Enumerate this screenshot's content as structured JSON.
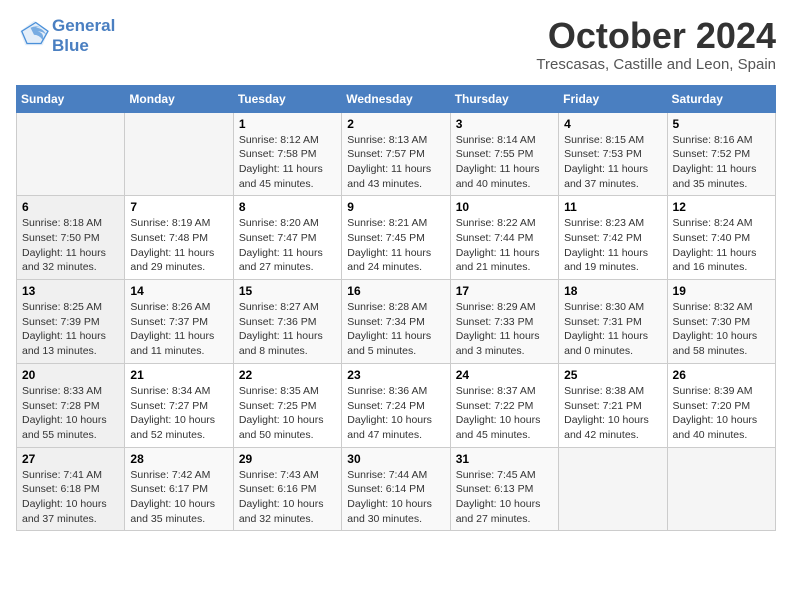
{
  "header": {
    "logo_line1": "General",
    "logo_line2": "Blue",
    "month": "October 2024",
    "location": "Trescasas, Castille and Leon, Spain"
  },
  "days_of_week": [
    "Sunday",
    "Monday",
    "Tuesday",
    "Wednesday",
    "Thursday",
    "Friday",
    "Saturday"
  ],
  "weeks": [
    [
      {
        "day": "",
        "info": ""
      },
      {
        "day": "",
        "info": ""
      },
      {
        "day": "1",
        "info": "Sunrise: 8:12 AM\nSunset: 7:58 PM\nDaylight: 11 hours and 45 minutes."
      },
      {
        "day": "2",
        "info": "Sunrise: 8:13 AM\nSunset: 7:57 PM\nDaylight: 11 hours and 43 minutes."
      },
      {
        "day": "3",
        "info": "Sunrise: 8:14 AM\nSunset: 7:55 PM\nDaylight: 11 hours and 40 minutes."
      },
      {
        "day": "4",
        "info": "Sunrise: 8:15 AM\nSunset: 7:53 PM\nDaylight: 11 hours and 37 minutes."
      },
      {
        "day": "5",
        "info": "Sunrise: 8:16 AM\nSunset: 7:52 PM\nDaylight: 11 hours and 35 minutes."
      }
    ],
    [
      {
        "day": "6",
        "info": "Sunrise: 8:18 AM\nSunset: 7:50 PM\nDaylight: 11 hours and 32 minutes."
      },
      {
        "day": "7",
        "info": "Sunrise: 8:19 AM\nSunset: 7:48 PM\nDaylight: 11 hours and 29 minutes."
      },
      {
        "day": "8",
        "info": "Sunrise: 8:20 AM\nSunset: 7:47 PM\nDaylight: 11 hours and 27 minutes."
      },
      {
        "day": "9",
        "info": "Sunrise: 8:21 AM\nSunset: 7:45 PM\nDaylight: 11 hours and 24 minutes."
      },
      {
        "day": "10",
        "info": "Sunrise: 8:22 AM\nSunset: 7:44 PM\nDaylight: 11 hours and 21 minutes."
      },
      {
        "day": "11",
        "info": "Sunrise: 8:23 AM\nSunset: 7:42 PM\nDaylight: 11 hours and 19 minutes."
      },
      {
        "day": "12",
        "info": "Sunrise: 8:24 AM\nSunset: 7:40 PM\nDaylight: 11 hours and 16 minutes."
      }
    ],
    [
      {
        "day": "13",
        "info": "Sunrise: 8:25 AM\nSunset: 7:39 PM\nDaylight: 11 hours and 13 minutes."
      },
      {
        "day": "14",
        "info": "Sunrise: 8:26 AM\nSunset: 7:37 PM\nDaylight: 11 hours and 11 minutes."
      },
      {
        "day": "15",
        "info": "Sunrise: 8:27 AM\nSunset: 7:36 PM\nDaylight: 11 hours and 8 minutes."
      },
      {
        "day": "16",
        "info": "Sunrise: 8:28 AM\nSunset: 7:34 PM\nDaylight: 11 hours and 5 minutes."
      },
      {
        "day": "17",
        "info": "Sunrise: 8:29 AM\nSunset: 7:33 PM\nDaylight: 11 hours and 3 minutes."
      },
      {
        "day": "18",
        "info": "Sunrise: 8:30 AM\nSunset: 7:31 PM\nDaylight: 11 hours and 0 minutes."
      },
      {
        "day": "19",
        "info": "Sunrise: 8:32 AM\nSunset: 7:30 PM\nDaylight: 10 hours and 58 minutes."
      }
    ],
    [
      {
        "day": "20",
        "info": "Sunrise: 8:33 AM\nSunset: 7:28 PM\nDaylight: 10 hours and 55 minutes."
      },
      {
        "day": "21",
        "info": "Sunrise: 8:34 AM\nSunset: 7:27 PM\nDaylight: 10 hours and 52 minutes."
      },
      {
        "day": "22",
        "info": "Sunrise: 8:35 AM\nSunset: 7:25 PM\nDaylight: 10 hours and 50 minutes."
      },
      {
        "day": "23",
        "info": "Sunrise: 8:36 AM\nSunset: 7:24 PM\nDaylight: 10 hours and 47 minutes."
      },
      {
        "day": "24",
        "info": "Sunrise: 8:37 AM\nSunset: 7:22 PM\nDaylight: 10 hours and 45 minutes."
      },
      {
        "day": "25",
        "info": "Sunrise: 8:38 AM\nSunset: 7:21 PM\nDaylight: 10 hours and 42 minutes."
      },
      {
        "day": "26",
        "info": "Sunrise: 8:39 AM\nSunset: 7:20 PM\nDaylight: 10 hours and 40 minutes."
      }
    ],
    [
      {
        "day": "27",
        "info": "Sunrise: 7:41 AM\nSunset: 6:18 PM\nDaylight: 10 hours and 37 minutes."
      },
      {
        "day": "28",
        "info": "Sunrise: 7:42 AM\nSunset: 6:17 PM\nDaylight: 10 hours and 35 minutes."
      },
      {
        "day": "29",
        "info": "Sunrise: 7:43 AM\nSunset: 6:16 PM\nDaylight: 10 hours and 32 minutes."
      },
      {
        "day": "30",
        "info": "Sunrise: 7:44 AM\nSunset: 6:14 PM\nDaylight: 10 hours and 30 minutes."
      },
      {
        "day": "31",
        "info": "Sunrise: 7:45 AM\nSunset: 6:13 PM\nDaylight: 10 hours and 27 minutes."
      },
      {
        "day": "",
        "info": ""
      },
      {
        "day": "",
        "info": ""
      }
    ]
  ]
}
